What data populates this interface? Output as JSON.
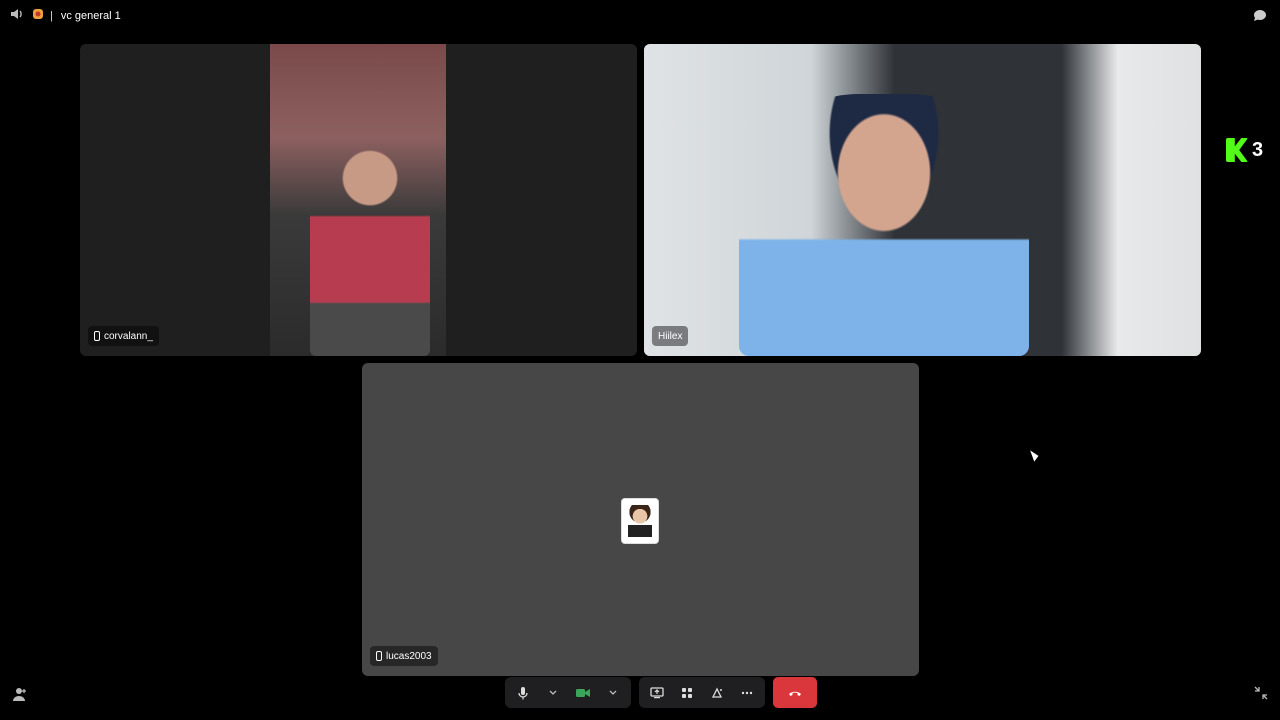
{
  "topbar": {
    "channel_name": "vc general 1",
    "separator": "|"
  },
  "tiles": [
    {
      "username": "corvalann_"
    },
    {
      "username": "Hiilex"
    },
    {
      "username": "lucas2003"
    }
  ],
  "overlay": {
    "brand_number": "3"
  },
  "colors": {
    "background": "#000000",
    "tile_dark": "#1f1f1f",
    "tile_avatar": "#474747",
    "speaking_ring": "#3ba55c",
    "end_call": "#da373c",
    "kick_green": "#53fc18"
  },
  "icons": {
    "volume": "speaker-icon",
    "server": "server-icon",
    "chat": "chat-icon",
    "mic": "microphone-icon",
    "camera": "camera-icon",
    "screen_share": "screen-share-icon",
    "activities": "activities-icon",
    "soundboard": "soundboard-icon",
    "more": "more-icon",
    "hangup": "hang-up-icon",
    "add_person": "add-user-icon",
    "minimize": "minimize-icon"
  }
}
